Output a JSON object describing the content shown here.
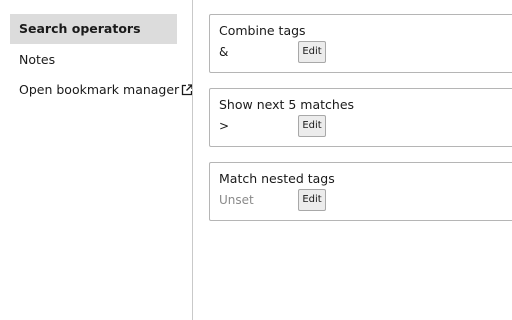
{
  "sidebar": {
    "items": [
      {
        "label": "Search operators",
        "active": true
      },
      {
        "label": "Notes"
      },
      {
        "label": "Open bookmark manager",
        "icon": "external-link-icon"
      }
    ]
  },
  "operators": [
    {
      "title": "Combine tags",
      "value": "&",
      "edit_label": "Edit"
    },
    {
      "title": "Show next 5 matches",
      "value": ">",
      "edit_label": "Edit"
    },
    {
      "title": "Match nested tags",
      "value": "Unset",
      "edit_label": "Edit"
    }
  ],
  "colors": {
    "active_bg": "#dcdcdc",
    "divider": "#c9c9c9",
    "unset_text": "#8a8a8a"
  }
}
